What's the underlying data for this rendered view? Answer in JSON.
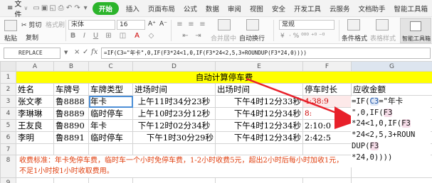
{
  "menu": {
    "file_label": "文件",
    "file_chevron": "∨",
    "quick_icons": [
      "save-icon",
      "print-icon",
      "print-preview-icon",
      "export-icon",
      "undo-icon",
      "redo-icon",
      "more-icon"
    ],
    "quick_glyphs": [
      "▭",
      "▣",
      "◱",
      "⎙",
      "↶",
      "↷",
      "▾"
    ],
    "tabs": [
      "开始",
      "插入",
      "页面布局",
      "公式",
      "数据",
      "审阅",
      "视图",
      "安全",
      "开发工具",
      "云服务",
      "文档助手",
      "智能工具箱"
    ],
    "active_tab": 0
  },
  "ribbon": {
    "cut": "✂ 剪切",
    "paste": "粘贴",
    "copy": "复制",
    "format_painter": "格式刷",
    "font_name": "宋体",
    "font_size": "16",
    "grow_font": "A⁺",
    "shrink_font": "A⁻",
    "format_buttons": [
      "B",
      "I",
      "U",
      "⊞",
      "◫",
      "A",
      "◇"
    ],
    "align_buttons": [
      "≡",
      "≡",
      "≡",
      "⇤",
      "⇥"
    ],
    "merge_center": "合并居中",
    "auto_wrap": "自动换行",
    "number_format": "常规",
    "currency": "¥",
    "number_buttons": "· % ⁰⁰⁰ ⁺⁰ ⁻⁰",
    "conditional_format": "条件格式",
    "table_style": "表格样式",
    "smart_toolbox": "智能工具箱"
  },
  "formula_bar": {
    "name_box": "REPLACE",
    "cancel_icon": "×",
    "confirm_icon": "✓",
    "fx": "fx",
    "formula": "=IF(C3=\"年卡\",0,IF(F3*24<1,0,IF(F3*24<2,5,3+ROUNDUP(F3*24,0))))"
  },
  "columns": [
    "A",
    "B",
    "C",
    "D",
    "E",
    "F",
    "G"
  ],
  "rows": [
    "1",
    "2",
    "3",
    "4",
    "5",
    "6",
    "7",
    "8",
    "9"
  ],
  "sheet": {
    "title": "自动计算停车费",
    "headers": [
      "姓名",
      "车牌号",
      "车牌类型",
      "进场时间",
      "出场时间",
      "停车时长",
      "应收金额"
    ],
    "data": [
      {
        "name": "张文孝",
        "plate": "鲁8888",
        "type": "年卡",
        "in": "上午11时34分23秒",
        "out": "下午4时12分33秒",
        "dur": "4:38:9",
        "fee": ""
      },
      {
        "name": "李琳琳",
        "plate": "鲁8889",
        "type": "临时停车",
        "in": "上午10时23分12秒",
        "out": "下午4时12分34秒",
        "dur": "8:",
        "fee": ""
      },
      {
        "name": "王友良",
        "plate": "鲁8890",
        "type": "年卡",
        "in": "下午12时02分34秒",
        "out": "下午4时12分34秒",
        "dur": "2:10:0",
        "fee": ""
      },
      {
        "name": "李明",
        "plate": "鲁8891",
        "type": "临时停车",
        "in": "下午1时30分29秒",
        "out": "下午4时12分34秒",
        "dur": "2:42:5",
        "fee": ""
      }
    ],
    "note": "收费标准：年卡免停车费，临时车一个小时免停车费，1-2小时收费5元，超出2小时后每小时加收1元，不足1小时按1小时收取费用。"
  },
  "callout": {
    "lines": [
      [
        "=IF(",
        "C3",
        "=\"年卡"
      ],
      [
        "\",0,IF(",
        "F3",
        ""
      ],
      [
        "*24<1,0,IF(",
        "F3",
        ""
      ],
      [
        "*24<2,5,3+ROUN",
        "",
        ""
      ],
      [
        "DUP(",
        "F3",
        ""
      ],
      [
        "*24,0))))",
        "",
        ""
      ]
    ]
  },
  "colors": {
    "accent": "#2bb42b",
    "title_fill": "#ffff00",
    "arrow": "#e8202a",
    "note_text": "#e04010",
    "selection": "#4c8fd6"
  }
}
